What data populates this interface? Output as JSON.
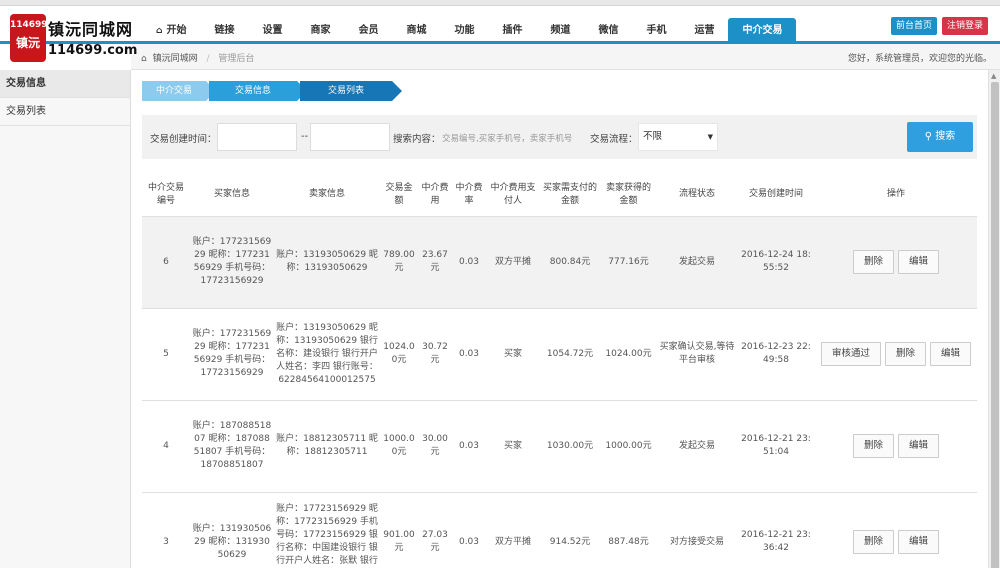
{
  "header": {
    "logo": {
      "badge_number": "114699",
      "badge_char": "镇沅",
      "title": "镇沅同城网",
      "domain": "114699.com"
    },
    "nav": [
      {
        "label": "开始",
        "icon": "home-icon"
      },
      {
        "label": "链接"
      },
      {
        "label": "设置"
      },
      {
        "label": "商家"
      },
      {
        "label": "会员"
      },
      {
        "label": "商城"
      },
      {
        "label": "功能"
      },
      {
        "label": "插件"
      },
      {
        "label": "频道"
      },
      {
        "label": "微信"
      },
      {
        "label": "手机"
      },
      {
        "label": "运营"
      },
      {
        "label": "中介交易",
        "active": true
      }
    ],
    "front_btn": "前台首页",
    "logout_btn": "注销登录"
  },
  "breadcrumb": {
    "site": "镇沅同城网",
    "current": "管理后台"
  },
  "welcome": "您好，系统管理员，欢迎您的光临。",
  "sidebar": {
    "items": [
      {
        "label": "交易信息",
        "active": true
      },
      {
        "label": "交易列表"
      }
    ]
  },
  "steps": [
    "中介交易",
    "交易信息",
    "交易列表"
  ],
  "filter": {
    "time_label": "交易创建时间：",
    "dash": "--",
    "search_label": "搜索内容：",
    "search_placeholder": "交易编号,买家手机号，卖家手机号",
    "flow_label": "交易流程：",
    "flow_value": "不限",
    "search_btn": "搜索"
  },
  "table": {
    "headers": [
      "中介交易编号",
      "买家信息",
      "卖家信息",
      "交易金额",
      "中介费用",
      "中介费率",
      "中介费用支付人",
      "买家需支付的金额",
      "卖家获得的金额",
      "流程状态",
      "交易创建时间",
      "操作"
    ],
    "rows": [
      {
        "id": "6",
        "buyer": "账户：17723156929 昵称：17723156929 手机号码：17723156929",
        "seller": "账户：13193050629 昵称：13193050629",
        "amount": "789.00元",
        "fee": "23.67元",
        "rate": "0.03",
        "payer": "双方平摊",
        "buyer_pay": "800.84元",
        "seller_get": "777.16元",
        "status": "发起交易",
        "created": "2016-12-24 18:55:52",
        "actions": [
          "删除",
          "编辑"
        ]
      },
      {
        "id": "5",
        "buyer": "账户：17723156929 昵称：17723156929 手机号码：17723156929",
        "seller": "账户：13193050629 昵称：13193050629 银行名称：建设银行 银行开户人姓名：李四 银行账号：62284564100012575",
        "amount": "1024.00元",
        "fee": "30.72元",
        "rate": "0.03",
        "payer": "买家",
        "buyer_pay": "1054.72元",
        "seller_get": "1024.00元",
        "status": "买家确认交易,等待平台审核",
        "created": "2016-12-23 22:49:58",
        "actions": [
          "审核通过",
          "删除",
          "编辑"
        ]
      },
      {
        "id": "4",
        "buyer": "账户：18708851807 昵称：18708851807 手机号码：18708851807",
        "seller": "账户：18812305711 昵称：18812305711",
        "amount": "1000.00元",
        "fee": "30.00元",
        "rate": "0.03",
        "payer": "买家",
        "buyer_pay": "1030.00元",
        "seller_get": "1000.00元",
        "status": "发起交易",
        "created": "2016-12-21 23:51:04",
        "actions": [
          "删除",
          "编辑"
        ]
      },
      {
        "id": "3",
        "buyer": "账户：13193050629 昵称：13193050629",
        "seller": "账户：17723156929 昵称：17723156929 手机号码：17723156929 银行名称：中国建设银行 银行开户人姓名：张默 银行账号：",
        "amount": "901.00元",
        "fee": "27.03元",
        "rate": "0.03",
        "payer": "双方平摊",
        "buyer_pay": "914.52元",
        "seller_get": "887.48元",
        "status": "对方接受交易",
        "created": "2016-12-21 23:36:42",
        "actions": [
          "删除",
          "编辑"
        ]
      }
    ]
  }
}
